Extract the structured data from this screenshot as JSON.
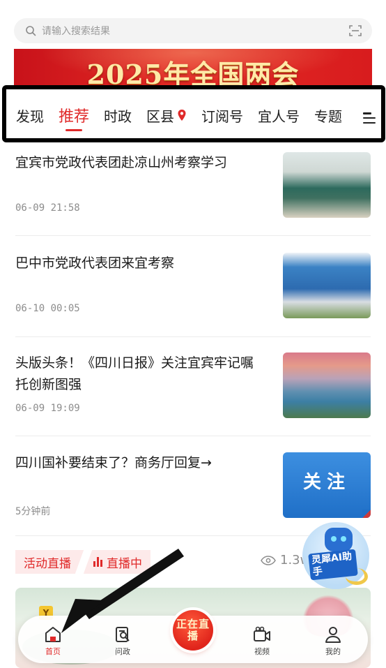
{
  "search": {
    "placeholder": "请输入搜索结果",
    "icon": "search-icon",
    "scan_icon": "scan-icon"
  },
  "banner": {
    "text": "2025年全国两会"
  },
  "tabs": [
    {
      "label": "发现"
    },
    {
      "label": "推荐",
      "active": true
    },
    {
      "label": "时政"
    },
    {
      "label": "区县",
      "icon": "location-pin-icon"
    },
    {
      "label": "订阅号"
    },
    {
      "label": "宜人号"
    },
    {
      "label": "专题"
    }
  ],
  "tabs_menu_icon": "menu-icon",
  "news": [
    {
      "title": "宜宾市党政代表团赴凉山州考察学习",
      "time": "06-09 21:58"
    },
    {
      "title": "巴中市党政代表团来宜考察",
      "time": "06-10 00:05"
    },
    {
      "title": "头版头条！《四川日报》关注宜宾牢记嘱托创新图强",
      "time": "06-09 19:09"
    },
    {
      "title": "四川国补要结束了？商务厅回复→",
      "time": "5分钟前",
      "thumb_text": "关注"
    }
  ],
  "live": {
    "tag": "活动直播",
    "status": "直播中",
    "views": "1.3w"
  },
  "ai_helper": {
    "label": "灵犀AI助手"
  },
  "video_card": {
    "tag": "Y"
  },
  "bottom_nav": {
    "items": [
      {
        "label": "首页",
        "icon": "home-icon",
        "active": true
      },
      {
        "label": "问政",
        "icon": "inquiry-icon"
      },
      {
        "label": "视频",
        "icon": "video-camera-icon"
      },
      {
        "label": "我的",
        "icon": "user-icon"
      }
    ],
    "live_button": "正在直播"
  },
  "colors": {
    "accent": "#e02a2a",
    "banner": "#d81c1e",
    "follow_blue": "#2a7fd6"
  }
}
